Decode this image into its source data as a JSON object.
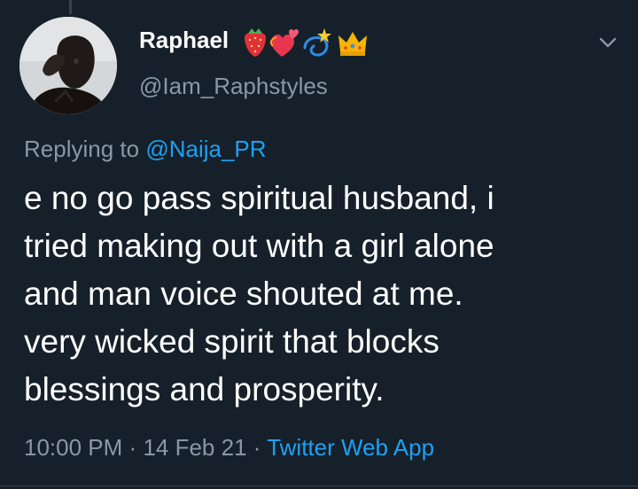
{
  "tweet": {
    "author": {
      "display_name": "Raphael",
      "name_emojis": [
        "strawberry-emoji",
        "revolving-hearts-emoji",
        "dizzy-emoji",
        "crown-emoji"
      ],
      "handle": "@Iam_Raphstyles",
      "avatar": "profile-photo"
    },
    "menu_icon": "chevron-down-icon",
    "reply": {
      "prefix": "Replying to",
      "target": "@Naija_PR"
    },
    "text_lines": [
      "e no go pass spiritual husband, i",
      "tried making out with a girl alone",
      "and man voice shouted at me.",
      "very wicked spirit that blocks",
      "blessings and prosperity."
    ],
    "time": "10:00 PM",
    "separator": "·",
    "date": "14 Feb 21",
    "source": "Twitter Web App"
  },
  "colors": {
    "background": "#15202b",
    "primary_text": "#ffffff",
    "secondary_text": "#8899a6",
    "link": "#1da1f2",
    "divider": "#38444d"
  }
}
